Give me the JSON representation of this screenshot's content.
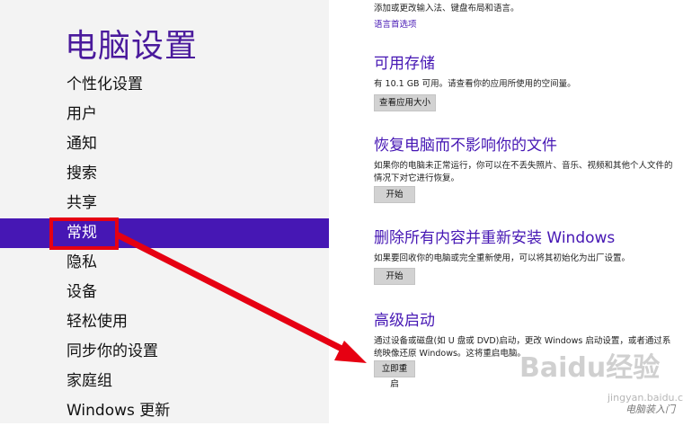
{
  "sidebar": {
    "title": "电脑设置",
    "items": [
      {
        "label": "个性化设置"
      },
      {
        "label": "用户"
      },
      {
        "label": "通知"
      },
      {
        "label": "搜索"
      },
      {
        "label": "共享"
      },
      {
        "label": "常规",
        "active": true
      },
      {
        "label": "隐私"
      },
      {
        "label": "设备"
      },
      {
        "label": "轻松使用"
      },
      {
        "label": "同步你的设置"
      },
      {
        "label": "家庭组"
      },
      {
        "label": "Windows 更新"
      }
    ]
  },
  "content": {
    "top_desc": "添加或更改输入法、键盘布局和语言。",
    "language_link": "语言首选项",
    "storage": {
      "title": "可用存储",
      "desc": "有 10.1 GB 可用。请查看你的应用所使用的空间量。",
      "button": "查看应用大小"
    },
    "refresh": {
      "title": "恢复电脑而不影响你的文件",
      "desc": "如果你的电脑未正常运行，你可以在不丢失照片、音乐、视频和其他个人文件的情况下对它进行恢复。",
      "button": "开始"
    },
    "reset": {
      "title": "删除所有内容并重新安装 Windows",
      "desc": "如果要回收你的电脑或完全重新使用，可以将其初始化为出厂设置。",
      "button": "开始"
    },
    "advanced": {
      "title": "高级启动",
      "desc": "通过设备或磁盘(如 U 盘或 DVD)启动，更改 Windows 启动设置，或者通过系统映像还原 Windows。这将重启电脑。",
      "button": "立即重启"
    }
  },
  "watermark": {
    "brand": "Baidu经验",
    "url": "jingyan.baidu.com",
    "author": "电脑装入门"
  },
  "colors": {
    "accent": "#4617b4",
    "annotation": "#e60012"
  }
}
